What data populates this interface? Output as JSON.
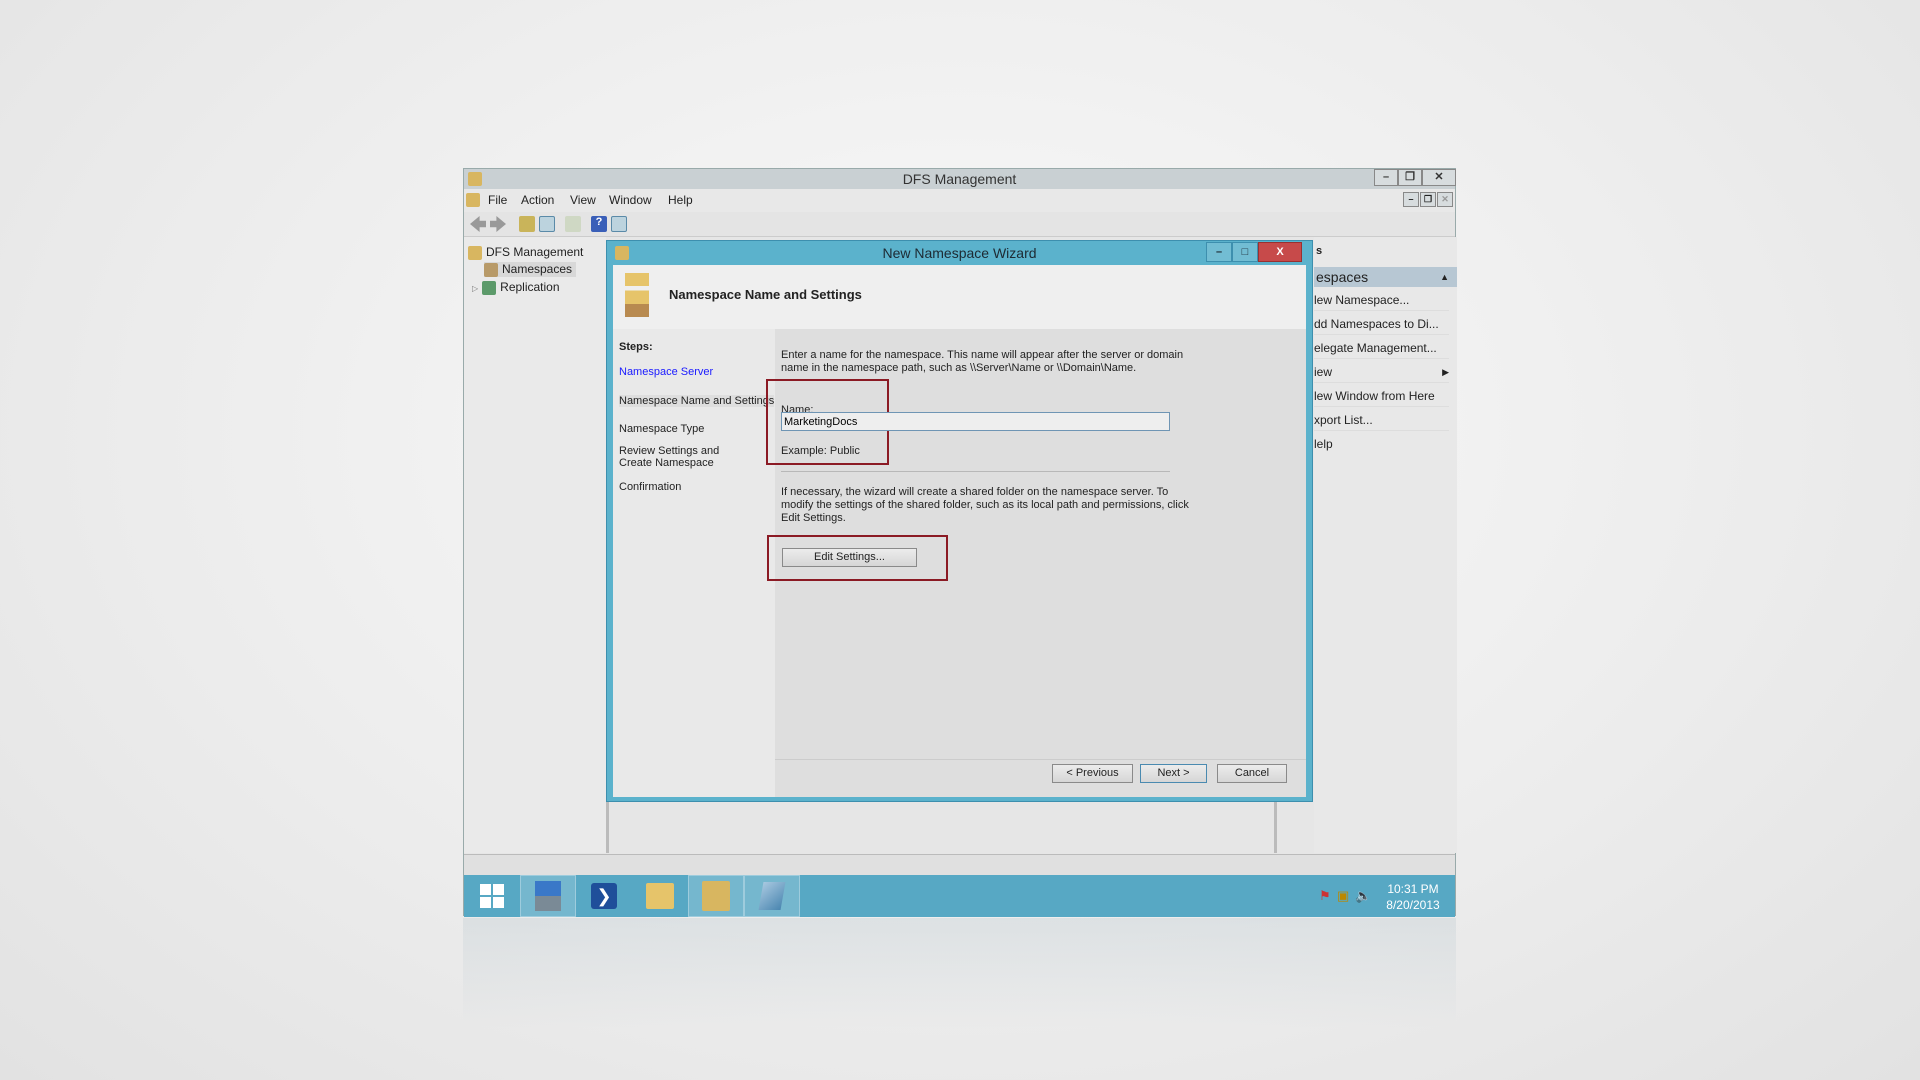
{
  "main_window": {
    "title": "DFS Management",
    "controls": {
      "minimize": "–",
      "restore": "❐",
      "close": "✕"
    },
    "menu": [
      "File",
      "Action",
      "View",
      "Window",
      "Help"
    ],
    "tree": [
      {
        "label": "DFS Management"
      },
      {
        "label": "Namespaces"
      },
      {
        "label": "Replication"
      }
    ],
    "actions": {
      "section_partial": "s",
      "header": "espaces",
      "items": [
        "lew Namespace...",
        "dd Namespaces to Di...",
        "elegate Management...",
        "iew",
        "lew Window from Here",
        "xport List...",
        "lelp"
      ]
    }
  },
  "wizard": {
    "title": "New Namespace Wizard",
    "header": "Namespace Name and Settings",
    "steps_label": "Steps:",
    "steps": [
      "Namespace Server",
      "Namespace Name and Settings",
      "Namespace Type",
      "Review Settings and Create Namespace",
      "Confirmation"
    ],
    "intro_line1": "Enter a name for the namespace. This name will appear after the server or domain",
    "intro_line2": "name in the namespace path, such as \\\\Server\\Name or \\\\Domain\\Name.",
    "name_label": "Name:",
    "name_value": "MarketingDocs",
    "example": "Example: Public",
    "info_line1": "If necessary, the wizard will create a shared folder on the namespace server. To",
    "info_line2": "modify the settings of the shared folder, such as its local path and permissions, click",
    "info_line3": "Edit Settings.",
    "edit_settings": "Edit Settings...",
    "previous": "< Previous",
    "next": "Next >",
    "cancel": "Cancel",
    "controls": {
      "minimize": "–",
      "maximize": "□",
      "close": "X"
    }
  },
  "taskbar": {
    "time": "10:31 PM",
    "date": "8/20/2013"
  },
  "colors": {
    "accent": "#57a8c4",
    "highlight_box": "#8b1a24",
    "close_red": "#c74a4a",
    "link_blue": "#1a1aff"
  }
}
